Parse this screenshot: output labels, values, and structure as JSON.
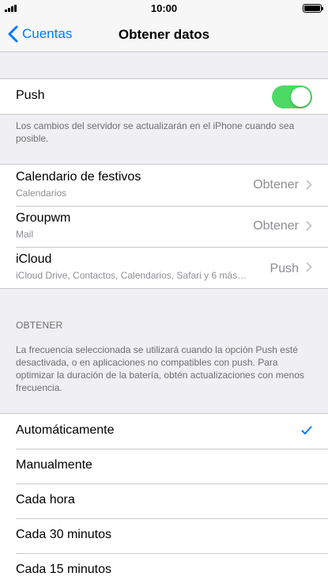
{
  "status_bar": {
    "time": "10:00"
  },
  "nav": {
    "back_label": "Cuentas",
    "title": "Obtener datos"
  },
  "push": {
    "label": "Push",
    "enabled": true,
    "footnote": "Los cambios del servidor se actualizarán en el iPhone cuando sea posible."
  },
  "accounts": [
    {
      "name": "Calendario de festivos",
      "subtitle": "Calendarios",
      "value": "Obtener"
    },
    {
      "name": "Groupwm",
      "subtitle": "Mail",
      "value": "Obtener"
    },
    {
      "name": "iCloud",
      "subtitle": "iCloud Drive, Contactos, Calendarios, Safari y 6 más…",
      "value": "Push"
    }
  ],
  "fetch": {
    "header": "OBTENER",
    "footnote": "La frecuencia seleccionada se utilizará cuando la opción Push esté desactivada, o en aplicaciones no compatibles con push. Para optimizar la duración de la batería, obtén actualizaciones con menos frecuencia.",
    "options": [
      {
        "label": "Automáticamente",
        "selected": true
      },
      {
        "label": "Manualmente"
      },
      {
        "label": "Cada hora"
      },
      {
        "label": "Cada 30 minutos"
      },
      {
        "label": "Cada 15 minutos"
      }
    ]
  },
  "colors": {
    "accent": "#007aff",
    "toggle_on": "#4cd964",
    "background": "#efeff4"
  },
  "icons": {
    "back": "chevron-left-icon",
    "disclosure": "chevron-right-icon",
    "selected": "checkmark-icon"
  }
}
